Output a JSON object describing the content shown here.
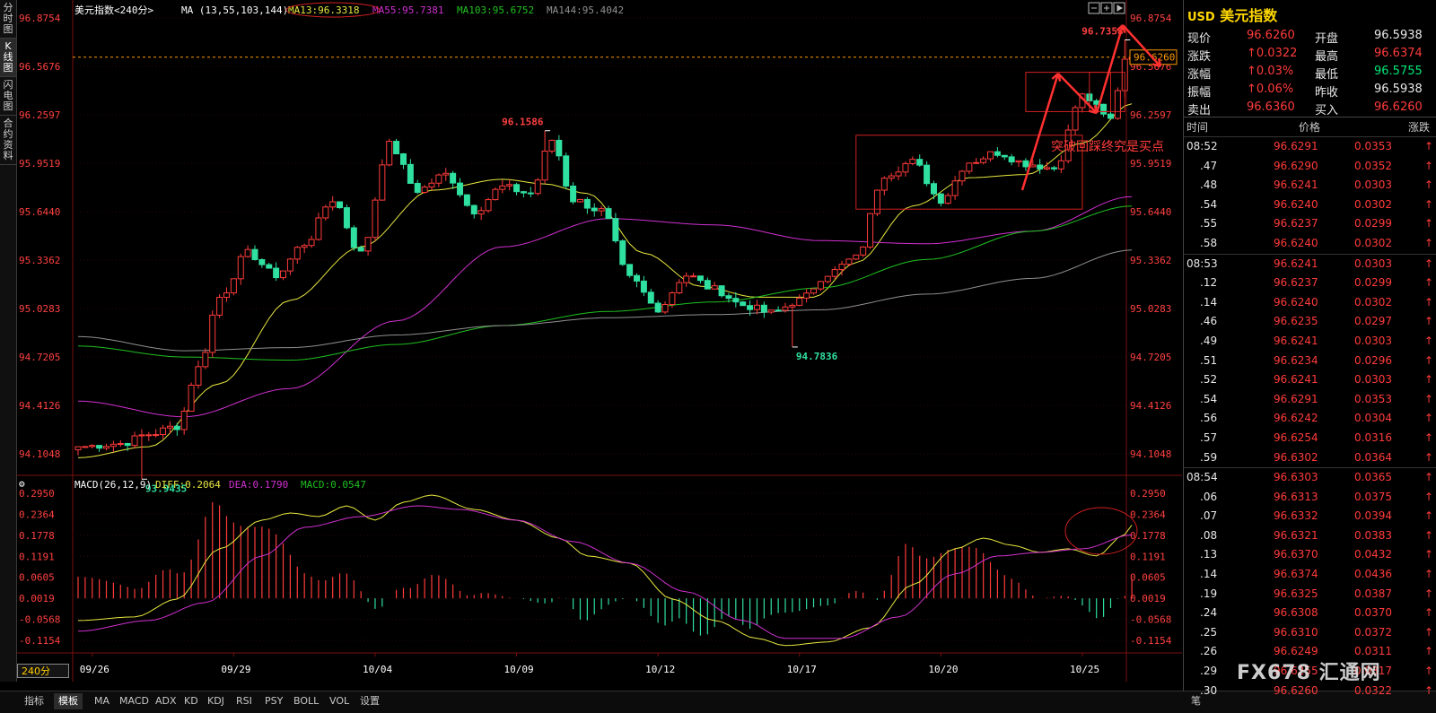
{
  "left_tabs": [
    "分时图",
    "K线图",
    "闪电图",
    "合约资料"
  ],
  "active_left_tab": 1,
  "legend": {
    "title": "美元指数<240分>",
    "ma_header": "MA (13,55,103,144)",
    "ma13": "MA13:96.3318",
    "ma55": "MA55:95.7381",
    "ma103": "MA103:95.6752",
    "ma144": "MA144:95.4042"
  },
  "macd_legend": {
    "label": "MACD(26,12,9)",
    "diff": "DIFF:0.2064",
    "dea": "DEA:0.1790",
    "macd": "MACD:0.0547"
  },
  "annotation_text": "突破回踩终究是买点",
  "period_badge": "240分",
  "bottom_tabs": [
    "指标",
    "模板",
    "MA",
    "MACD",
    "ADX",
    "KD",
    "KDJ",
    "RSI",
    "PSY",
    "BOLL",
    "VOL",
    "设置"
  ],
  "active_bottom_tab": 1,
  "right_bottom_tab": "笔",
  "watermark": "FX678 汇通网",
  "colors": {
    "up": "#ff3b3b",
    "down": "#2fe0a0",
    "ma13": "#e8e840",
    "ma55": "#d030d0",
    "ma103": "#20c020",
    "ma144": "#909090",
    "diff": "#e8e840",
    "dea": "#d030d0"
  },
  "quote": {
    "symbol": "USD",
    "name": "美元指数",
    "rows": [
      {
        "l1": "现价",
        "v1": "96.6260",
        "c1": "red",
        "l2": "开盘",
        "v2": "96.5938",
        "c2": "white"
      },
      {
        "l1": "涨跌",
        "v1": "↑0.0322",
        "c1": "red",
        "l2": "最高",
        "v2": "96.6374",
        "c2": "red"
      },
      {
        "l1": "涨幅",
        "v1": "↑0.03%",
        "c1": "red",
        "l2": "最低",
        "v2": "96.5755",
        "c2": "green"
      },
      {
        "l1": "振幅",
        "v1": "↑0.06%",
        "c1": "red",
        "l2": "昨收",
        "v2": "96.5938",
        "c2": "white"
      },
      {
        "l1": "卖出",
        "v1": "96.6360",
        "c1": "red",
        "l2": "买入",
        "v2": "96.6260",
        "c2": "red"
      }
    ],
    "tick_header": {
      "time": "时间",
      "price": "价格",
      "change": "涨跌"
    },
    "ticks": [
      {
        "t": "08:52",
        "p": "96.6291",
        "c": "0.0353",
        "m": true
      },
      {
        "t": ".47",
        "p": "96.6290",
        "c": "0.0352",
        "m": false
      },
      {
        "t": ".48",
        "p": "96.6241",
        "c": "0.0303",
        "m": false
      },
      {
        "t": ".54",
        "p": "96.6240",
        "c": "0.0302",
        "m": false
      },
      {
        "t": ".55",
        "p": "96.6237",
        "c": "0.0299",
        "m": false
      },
      {
        "t": ".58",
        "p": "96.6240",
        "c": "0.0302",
        "m": false
      },
      {
        "t": "08:53",
        "p": "96.6241",
        "c": "0.0303",
        "m": true
      },
      {
        "t": ".12",
        "p": "96.6237",
        "c": "0.0299",
        "m": false
      },
      {
        "t": ".14",
        "p": "96.6240",
        "c": "0.0302",
        "m": false
      },
      {
        "t": ".46",
        "p": "96.6235",
        "c": "0.0297",
        "m": false
      },
      {
        "t": ".49",
        "p": "96.6241",
        "c": "0.0303",
        "m": false
      },
      {
        "t": ".51",
        "p": "96.6234",
        "c": "0.0296",
        "m": false
      },
      {
        "t": ".52",
        "p": "96.6241",
        "c": "0.0303",
        "m": false
      },
      {
        "t": ".54",
        "p": "96.6291",
        "c": "0.0353",
        "m": false
      },
      {
        "t": ".56",
        "p": "96.6242",
        "c": "0.0304",
        "m": false
      },
      {
        "t": ".57",
        "p": "96.6254",
        "c": "0.0316",
        "m": false
      },
      {
        "t": ".59",
        "p": "96.6302",
        "c": "0.0364",
        "m": false
      },
      {
        "t": "08:54",
        "p": "96.6303",
        "c": "0.0365",
        "m": true
      },
      {
        "t": ".06",
        "p": "96.6313",
        "c": "0.0375",
        "m": false
      },
      {
        "t": ".07",
        "p": "96.6332",
        "c": "0.0394",
        "m": false
      },
      {
        "t": ".08",
        "p": "96.6321",
        "c": "0.0383",
        "m": false
      },
      {
        "t": ".13",
        "p": "96.6370",
        "c": "0.0432",
        "m": false
      },
      {
        "t": ".14",
        "p": "96.6374",
        "c": "0.0436",
        "m": false
      },
      {
        "t": ".19",
        "p": "96.6325",
        "c": "0.0387",
        "m": false
      },
      {
        "t": ".24",
        "p": "96.6308",
        "c": "0.0370",
        "m": false
      },
      {
        "t": ".25",
        "p": "96.6310",
        "c": "0.0372",
        "m": false
      },
      {
        "t": ".26",
        "p": "96.6249",
        "c": "0.0311",
        "m": false
      },
      {
        "t": ".29",
        "p": "96.6255",
        "c": "0.0317",
        "m": false
      },
      {
        "t": ".30",
        "p": "96.6260",
        "c": "0.0322",
        "m": false
      }
    ]
  },
  "chart_data": [
    {
      "type": "candlestick",
      "price_axis_labels": [
        "96.8754",
        "96.5676",
        "96.2597",
        "95.9519",
        "95.6440",
        "95.3362",
        "95.0283",
        "94.7205",
        "94.4126",
        "94.1048"
      ],
      "ylim": [
        94.1048,
        96.8754
      ],
      "current_price_label": "96.6260",
      "date_labels": [
        "09/26",
        "09/29",
        "10/04",
        "10/09",
        "10/12",
        "10/17",
        "10/20",
        "10/25"
      ],
      "date_label_bar_index": [
        2,
        22,
        42,
        62,
        82,
        102,
        122,
        142
      ],
      "extremes": [
        {
          "label": "93.9435",
          "bar": 9,
          "price": 93.9435
        },
        {
          "label": "96.1586",
          "bar": 66,
          "price": 96.1586
        },
        {
          "label": "94.7836",
          "bar": 101,
          "price": 94.7836
        },
        {
          "label": "96.7358",
          "bar": 148,
          "price": 96.7358
        }
      ],
      "anchors": [
        {
          "i": 0,
          "p": 94.15
        },
        {
          "i": 6,
          "p": 94.17
        },
        {
          "i": 10,
          "p": 94.23
        },
        {
          "i": 14,
          "p": 94.28
        },
        {
          "i": 17,
          "p": 94.65
        },
        {
          "i": 20,
          "p": 95.1
        },
        {
          "i": 24,
          "p": 95.38
        },
        {
          "i": 28,
          "p": 95.24
        },
        {
          "i": 32,
          "p": 95.44
        },
        {
          "i": 36,
          "p": 95.72
        },
        {
          "i": 40,
          "p": 95.38
        },
        {
          "i": 44,
          "p": 96.07
        },
        {
          "i": 48,
          "p": 95.78
        },
        {
          "i": 52,
          "p": 95.88
        },
        {
          "i": 56,
          "p": 95.65
        },
        {
          "i": 60,
          "p": 95.8
        },
        {
          "i": 64,
          "p": 95.76
        },
        {
          "i": 67,
          "p": 96.1
        },
        {
          "i": 70,
          "p": 95.72
        },
        {
          "i": 74,
          "p": 95.65
        },
        {
          "i": 78,
          "p": 95.22
        },
        {
          "i": 82,
          "p": 95.03
        },
        {
          "i": 86,
          "p": 95.24
        },
        {
          "i": 90,
          "p": 95.15
        },
        {
          "i": 94,
          "p": 95.05
        },
        {
          "i": 98,
          "p": 95.0
        },
        {
          "i": 102,
          "p": 95.08
        },
        {
          "i": 106,
          "p": 95.25
        },
        {
          "i": 110,
          "p": 95.35
        },
        {
          "i": 114,
          "p": 95.88
        },
        {
          "i": 118,
          "p": 95.96
        },
        {
          "i": 122,
          "p": 95.72
        },
        {
          "i": 126,
          "p": 95.96
        },
        {
          "i": 130,
          "p": 96.02
        },
        {
          "i": 134,
          "p": 95.95
        },
        {
          "i": 138,
          "p": 95.92
        },
        {
          "i": 142,
          "p": 96.38
        },
        {
          "i": 146,
          "p": 96.23
        },
        {
          "i": 148,
          "p": 96.62
        },
        {
          "i": 149,
          "p": 96.626
        }
      ],
      "ma_curves": {
        "ma13": [
          {
            "i": 0,
            "p": 94.08
          },
          {
            "i": 10,
            "p": 94.15
          },
          {
            "i": 20,
            "p": 94.55
          },
          {
            "i": 30,
            "p": 95.08
          },
          {
            "i": 40,
            "p": 95.42
          },
          {
            "i": 50,
            "p": 95.78
          },
          {
            "i": 60,
            "p": 95.85
          },
          {
            "i": 66,
            "p": 95.82
          },
          {
            "i": 72,
            "p": 95.76
          },
          {
            "i": 80,
            "p": 95.38
          },
          {
            "i": 88,
            "p": 95.17
          },
          {
            "i": 96,
            "p": 95.1
          },
          {
            "i": 104,
            "p": 95.1
          },
          {
            "i": 110,
            "p": 95.32
          },
          {
            "i": 118,
            "p": 95.68
          },
          {
            "i": 126,
            "p": 95.86
          },
          {
            "i": 134,
            "p": 95.88
          },
          {
            "i": 142,
            "p": 96.08
          },
          {
            "i": 149,
            "p": 96.33
          }
        ],
        "ma55": [
          {
            "i": 0,
            "p": 94.44
          },
          {
            "i": 15,
            "p": 94.34
          },
          {
            "i": 30,
            "p": 94.52
          },
          {
            "i": 45,
            "p": 94.95
          },
          {
            "i": 60,
            "p": 95.42
          },
          {
            "i": 75,
            "p": 95.6
          },
          {
            "i": 90,
            "p": 95.56
          },
          {
            "i": 105,
            "p": 95.46
          },
          {
            "i": 120,
            "p": 95.44
          },
          {
            "i": 135,
            "p": 95.52
          },
          {
            "i": 149,
            "p": 95.74
          }
        ],
        "ma103": [
          {
            "i": 0,
            "p": 94.79
          },
          {
            "i": 15,
            "p": 94.72
          },
          {
            "i": 30,
            "p": 94.7
          },
          {
            "i": 45,
            "p": 94.8
          },
          {
            "i": 60,
            "p": 94.92
          },
          {
            "i": 75,
            "p": 95.01
          },
          {
            "i": 90,
            "p": 95.07
          },
          {
            "i": 105,
            "p": 95.16
          },
          {
            "i": 120,
            "p": 95.34
          },
          {
            "i": 135,
            "p": 95.52
          },
          {
            "i": 149,
            "p": 95.68
          }
        ],
        "ma144": [
          {
            "i": 0,
            "p": 94.85
          },
          {
            "i": 15,
            "p": 94.76
          },
          {
            "i": 30,
            "p": 94.78
          },
          {
            "i": 45,
            "p": 94.86
          },
          {
            "i": 60,
            "p": 94.92
          },
          {
            "i": 75,
            "p": 94.97
          },
          {
            "i": 90,
            "p": 94.99
          },
          {
            "i": 105,
            "p": 95.02
          },
          {
            "i": 120,
            "p": 95.12
          },
          {
            "i": 135,
            "p": 95.22
          },
          {
            "i": 149,
            "p": 95.4
          }
        ]
      }
    },
    {
      "type": "macd",
      "axis_labels": [
        "0.2950",
        "0.2364",
        "0.1778",
        "0.1191",
        "0.0605",
        "0.0019",
        "-0.0568",
        "-0.1154"
      ],
      "ylim": [
        -0.1154,
        0.295
      ],
      "diff_anchors": [
        {
          "i": 0,
          "v": -0.06
        },
        {
          "i": 8,
          "v": -0.05
        },
        {
          "i": 14,
          "v": 0.0
        },
        {
          "i": 20,
          "v": 0.14
        },
        {
          "i": 26,
          "v": 0.22
        },
        {
          "i": 30,
          "v": 0.24
        },
        {
          "i": 34,
          "v": 0.23
        },
        {
          "i": 38,
          "v": 0.26
        },
        {
          "i": 42,
          "v": 0.22
        },
        {
          "i": 46,
          "v": 0.27
        },
        {
          "i": 50,
          "v": 0.29
        },
        {
          "i": 56,
          "v": 0.25
        },
        {
          "i": 62,
          "v": 0.22
        },
        {
          "i": 68,
          "v": 0.17
        },
        {
          "i": 72,
          "v": 0.12
        },
        {
          "i": 78,
          "v": 0.1
        },
        {
          "i": 84,
          "v": 0.0
        },
        {
          "i": 90,
          "v": -0.06
        },
        {
          "i": 96,
          "v": -0.11
        },
        {
          "i": 100,
          "v": -0.13
        },
        {
          "i": 106,
          "v": -0.12
        },
        {
          "i": 112,
          "v": -0.08
        },
        {
          "i": 118,
          "v": 0.04
        },
        {
          "i": 124,
          "v": 0.14
        },
        {
          "i": 128,
          "v": 0.17
        },
        {
          "i": 132,
          "v": 0.15
        },
        {
          "i": 136,
          "v": 0.13
        },
        {
          "i": 140,
          "v": 0.14
        },
        {
          "i": 144,
          "v": 0.12
        },
        {
          "i": 148,
          "v": 0.18
        },
        {
          "i": 149,
          "v": 0.2064
        }
      ],
      "dea_anchors": [
        {
          "i": 0,
          "v": -0.09
        },
        {
          "i": 10,
          "v": -0.06
        },
        {
          "i": 18,
          "v": -0.01
        },
        {
          "i": 26,
          "v": 0.12
        },
        {
          "i": 32,
          "v": 0.2
        },
        {
          "i": 40,
          "v": 0.23
        },
        {
          "i": 48,
          "v": 0.26
        },
        {
          "i": 54,
          "v": 0.25
        },
        {
          "i": 62,
          "v": 0.22
        },
        {
          "i": 70,
          "v": 0.16
        },
        {
          "i": 78,
          "v": 0.1
        },
        {
          "i": 86,
          "v": 0.02
        },
        {
          "i": 94,
          "v": -0.06
        },
        {
          "i": 100,
          "v": -0.11
        },
        {
          "i": 108,
          "v": -0.11
        },
        {
          "i": 116,
          "v": -0.05
        },
        {
          "i": 124,
          "v": 0.07
        },
        {
          "i": 130,
          "v": 0.12
        },
        {
          "i": 136,
          "v": 0.13
        },
        {
          "i": 142,
          "v": 0.14
        },
        {
          "i": 149,
          "v": 0.179
        }
      ]
    }
  ]
}
